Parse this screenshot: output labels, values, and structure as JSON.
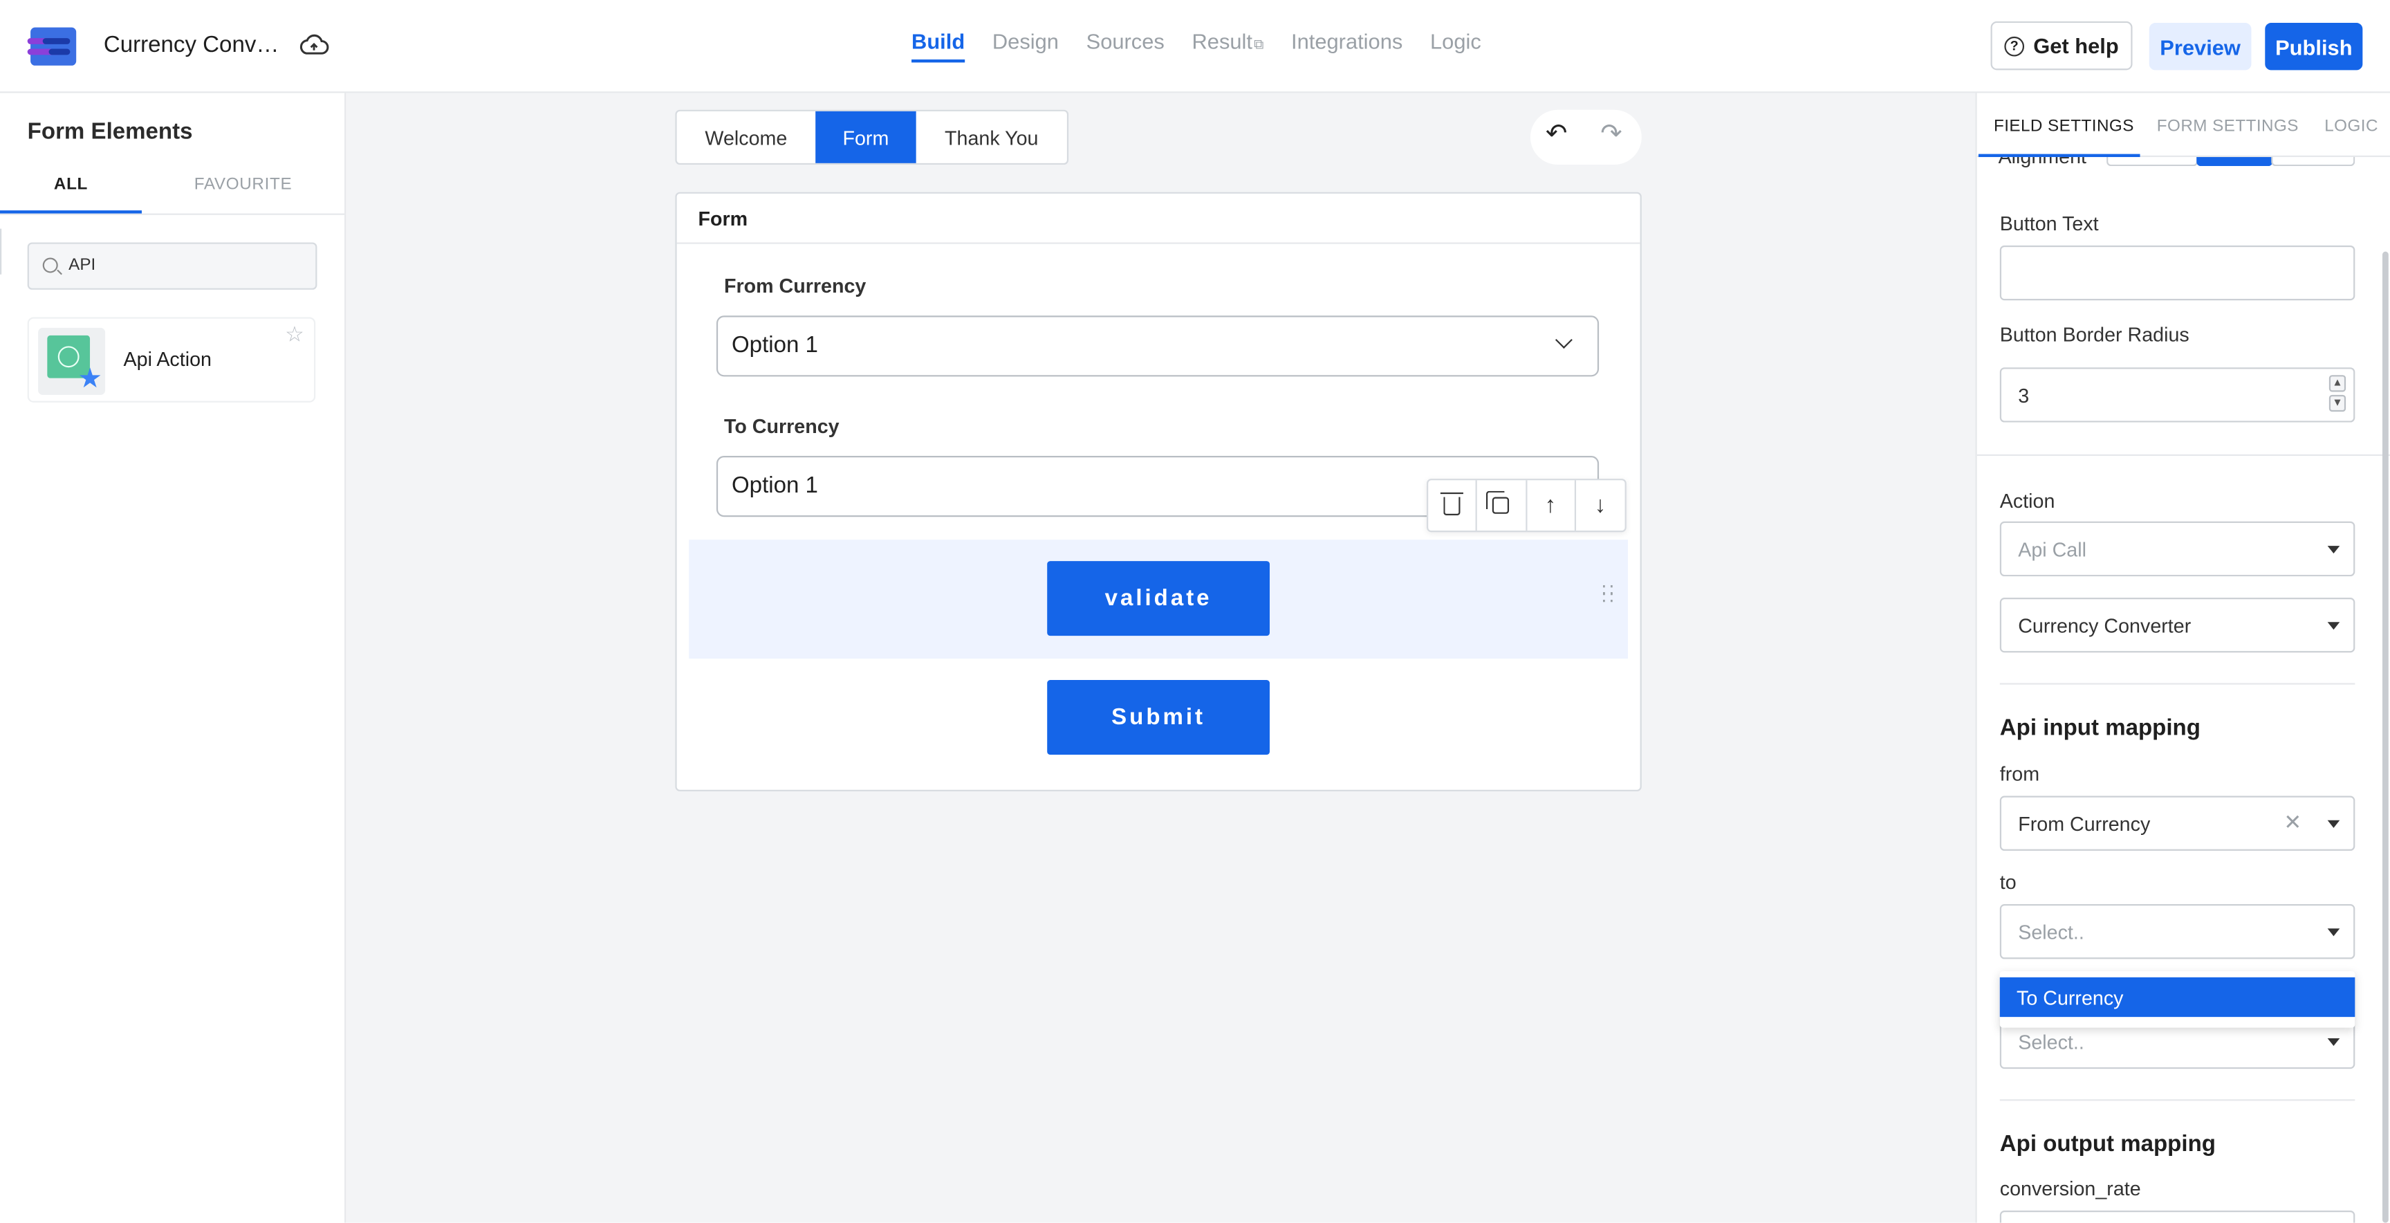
{
  "header": {
    "app_title": "Currency Conve...",
    "nav_tabs": [
      "Build",
      "Design",
      "Sources",
      "Result",
      "Integrations",
      "Logic"
    ],
    "active_tab": "Build",
    "help_label": "Get help",
    "preview_label": "Preview",
    "publish_label": "Publish"
  },
  "left_panel": {
    "title": "Form Elements",
    "tab_all": "ALL",
    "tab_favourite": "FAVOURITE",
    "search_value": "API",
    "element_label": "Api Action"
  },
  "canvas": {
    "segments": [
      "Welcome",
      "Form",
      "Thank You"
    ],
    "active_segment": "Form",
    "form_title": "Form",
    "from_label": "From Currency",
    "from_value": "Option 1",
    "to_label": "To Currency",
    "to_value": "Option 1",
    "validate_label": "validate",
    "submit_label": "Submit"
  },
  "right_panel": {
    "tabs": [
      "FIELD SETTINGS",
      "FORM SETTINGS",
      "LOGIC"
    ],
    "active_tab": "FIELD SETTINGS",
    "alignment_label": "Alignment",
    "button_text_label": "Button Text",
    "button_text_value": "",
    "border_radius_label": "Button Border Radius",
    "border_radius_value": "3",
    "action_label": "Action",
    "action_placeholder": "Api Call",
    "action_api_value": "Currency Converter",
    "input_mapping_heading": "Api input mapping",
    "from_label": "from",
    "from_value": "From Currency",
    "to_label": "to",
    "to_placeholder": "Select..",
    "dropdown_option": "To Currency",
    "third_placeholder": "Select..",
    "output_mapping_heading": "Api output mapping",
    "output_field_label": "conversion_rate"
  },
  "colors": {
    "accent": "#1565e8",
    "selected_row": "#eef3ff",
    "canvas_bg": "#f3f4f6"
  }
}
